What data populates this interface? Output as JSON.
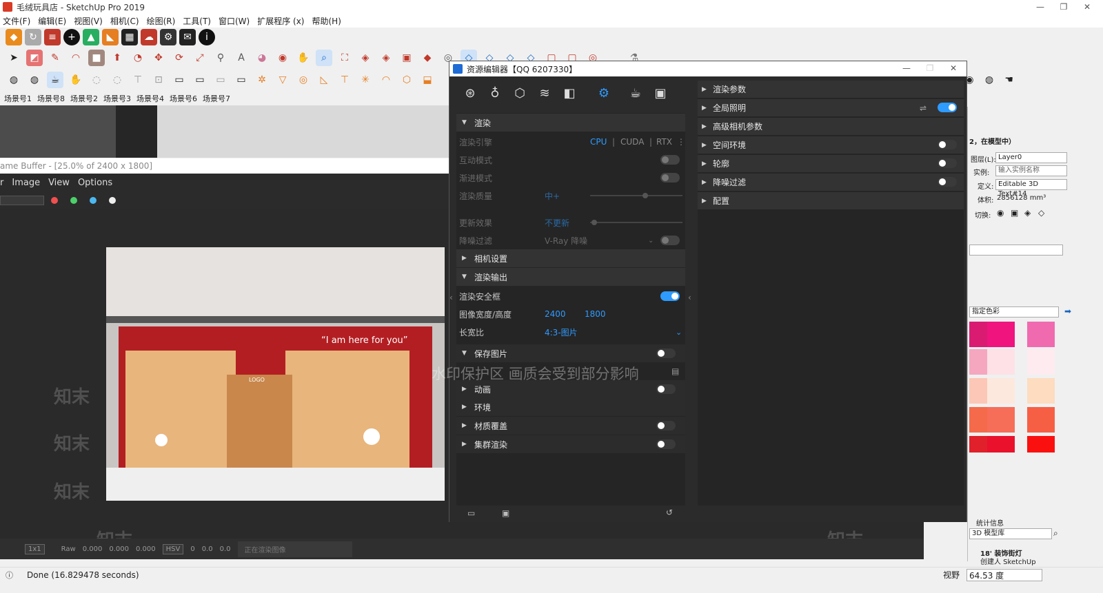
{
  "window": {
    "title": "毛绒玩具店 - SketchUp Pro 2019",
    "min": "—",
    "max": "❐",
    "close": "✕"
  },
  "menu": [
    "文件(F)",
    "编辑(E)",
    "视图(V)",
    "相机(C)",
    "绘图(R)",
    "工具(T)",
    "窗口(W)",
    "扩展程序 (x)",
    "帮助(H)"
  ],
  "scenes": [
    "场景号1",
    "场景号8",
    "场景号2",
    "场景号3",
    "场景号4",
    "场景号6",
    "场景号7"
  ],
  "framebuffer": {
    "title": "ame Buffer - [25.0% of 2400 x 1800]",
    "menu": [
      "r",
      "Image",
      "View",
      "Options"
    ],
    "status": {
      "ratio": "1x1",
      "raw": "Raw",
      "v1": "0.000",
      "v2": "0.000",
      "v3": "0.000",
      "mode": "HSV",
      "h": "0",
      "s": "0.0",
      "v": "0.0",
      "render_status": "正在渲染图像"
    }
  },
  "render": {
    "slogan": "“I am here for you”",
    "logo": "LOGO"
  },
  "watermark": {
    "mark": "知末",
    "notice": "水印保护区   画质会受到部分影响"
  },
  "asset_editor": {
    "title": "资源编辑器【QQ 6207330】",
    "left": {
      "render_section": "渲染",
      "engine_label": "渲染引擎",
      "engines": [
        "CPU",
        "CUDA",
        "RTX"
      ],
      "interactive": "互动模式",
      "progressive": "渐进模式",
      "quality_label": "渲染质量",
      "quality_value": "中+",
      "update_label": "更新效果",
      "update_value": "不更新",
      "denoise_label": "降噪过滤",
      "denoise_value": "V-Ray 降噪",
      "camera_section": "相机设置",
      "output_section": "渲染输出",
      "safe_frame": "渲染安全框",
      "size_label": "图像宽度/高度",
      "width": "2400",
      "height": "1800",
      "aspect_label": "长宽比",
      "aspect_value": "4:3-图片",
      "save_section": "保存图片",
      "animation_section": "动画",
      "env_section": "环境",
      "material_override": "材质覆盖",
      "swarm": "集群渲染"
    },
    "right": [
      "渲染参数",
      "全局照明",
      "高级相机参数",
      "空间环境",
      "轮廓",
      "降噪过滤",
      "配置"
    ]
  },
  "entity_info": {
    "header": "2，在模型中）",
    "layer_label": "图层(L):",
    "layer_value": "Layer0",
    "instance_label": "实例:",
    "instance_placeholder": "输入实例名称",
    "def_label": "定义:",
    "def_value": "Editable 3D Text#14",
    "volume_label": "体积:",
    "volume_value": "2856128 mm³",
    "toggle_label": "切换:",
    "color_select": "指定色彩",
    "stats": "统计信息",
    "search_value": "3D 模型库",
    "component_title": "18' 装饰街灯",
    "component_sub": "创建人 SketchUp"
  },
  "colors": {
    "swatches": [
      "#d91c72",
      "#f0147e",
      "#f06ab0",
      "#f5a7c0",
      "#fde1e6",
      "#fdebf0",
      "#fcc7b6",
      "#fde8dd",
      "#fddcc0",
      "#f46a4a",
      "#f66d58",
      "#f75f45",
      "#e0202a",
      "#e9112c",
      "#fb1010"
    ]
  },
  "statusbar": {
    "done": "Done (16.829478 seconds)",
    "fov_label": "视野",
    "fov_value": "64.53 度"
  }
}
